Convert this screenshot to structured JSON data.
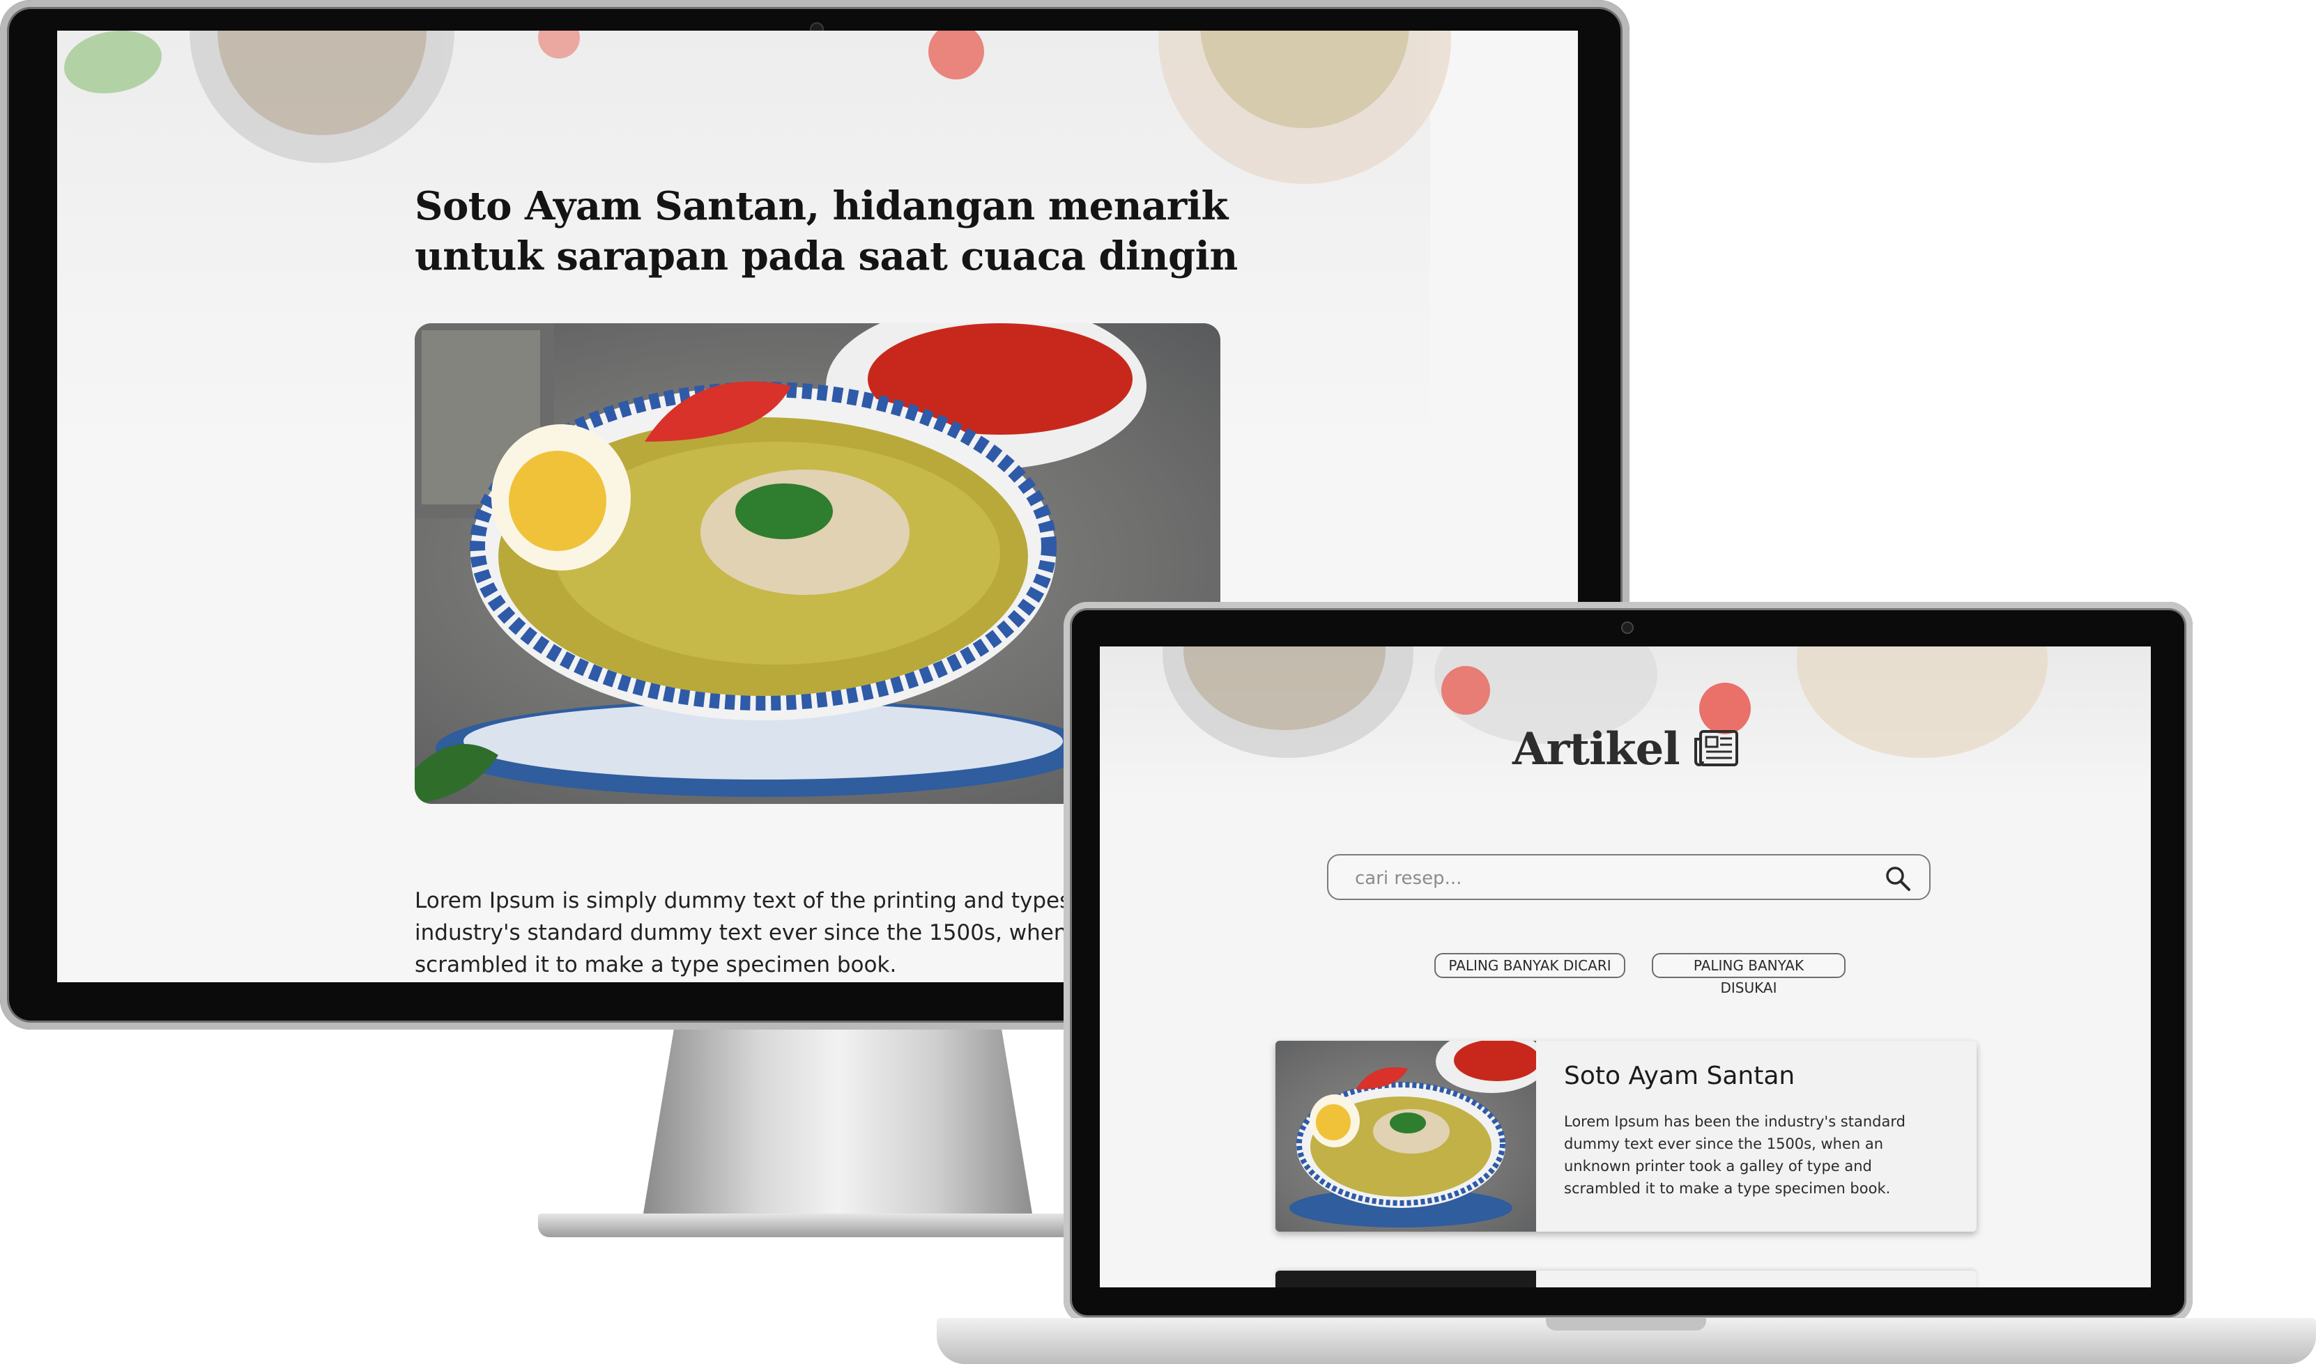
{
  "desktop": {
    "article": {
      "title": "Soto Ayam Santan, hidangan menarik untuk sarapan pada saat cuaca dingin",
      "body": "Lorem Ipsum is simply dummy text of the printing and typesetting industry. Lorem Ipsum has been the industry's standard dummy text ever since the 1500s, when an unknown printer took a galley of type and scrambled it to make a type specimen book."
    }
  },
  "laptop": {
    "page_title": "Artikel",
    "title_icon": "newspaper-icon",
    "search": {
      "placeholder": "cari resep...",
      "icon": "search-icon"
    },
    "filters": [
      "PALING BANYAK DICARI",
      "PALING BANYAK DISUKAI"
    ],
    "cards": [
      {
        "title": "Soto Ayam Santan",
        "text": "Lorem Ipsum has been the industry's standard dummy text ever since the 1500s, when an unknown printer took a galley of type and scrambled it to make a type specimen book."
      }
    ]
  },
  "colors": {
    "screen_bg": "#f6f6f6",
    "text": "#141414",
    "bezel": "#0b0b0b"
  }
}
